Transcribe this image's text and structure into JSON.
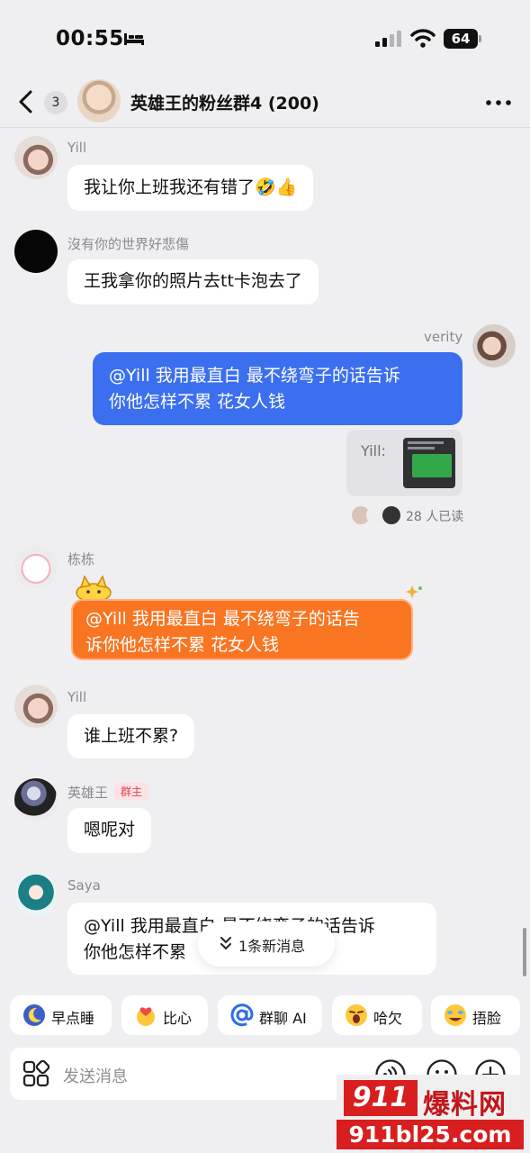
{
  "status_bar": {
    "time": "00:55",
    "battery": "64"
  },
  "header": {
    "back_count": "3",
    "title": "英雄王的粉丝群4 (200)"
  },
  "messages": [
    {
      "sender": "Yill",
      "text": "我让你上班我还有错了🤣👍"
    },
    {
      "sender": "沒有你的世界好悲傷",
      "text": "王我拿你的照片去tt卡泡去了"
    },
    {
      "sender": "verity",
      "text_line1": "@Yill 我用最直白 最不绕弯子的话告诉",
      "text_line2": "你他怎样不累 花女人钱",
      "quote_name": "Yill:",
      "read_text": "28 人已读"
    },
    {
      "sender": "栋栋",
      "text_line1": "@Yill 我用最直白 最不绕弯子的话告",
      "text_line2": "诉你他怎样不累 花女人钱"
    },
    {
      "sender": "Yill",
      "text": "谁上班不累?"
    },
    {
      "sender": "英雄王",
      "tag": "群主",
      "text": "嗯呢对"
    },
    {
      "sender": "Saya",
      "text_line1": "@Yill 我用最直白 最不绕弯子的话告诉",
      "text_line2": "你他怎样不累"
    }
  ],
  "new_messages": "1条新消息",
  "quick_replies": [
    {
      "label": "早点睡",
      "icon": "moon-emoji-icon"
    },
    {
      "label": "比心",
      "icon": "heart-hands-emoji-icon"
    },
    {
      "label": "群聊 AI",
      "icon": "at-sign-icon"
    },
    {
      "label": "哈欠",
      "icon": "yawn-emoji-icon"
    },
    {
      "label": "捂脸",
      "icon": "facepalm-emoji-icon"
    }
  ],
  "input": {
    "placeholder": "发送消息"
  },
  "watermark": {
    "top_num": "911",
    "top_cn": "爆料网",
    "domain": "911bl25.com"
  },
  "colors": {
    "accent_blue": "#3b6ff0",
    "highlight_orange": "#f97522",
    "owner_tag": "#e3424f"
  }
}
